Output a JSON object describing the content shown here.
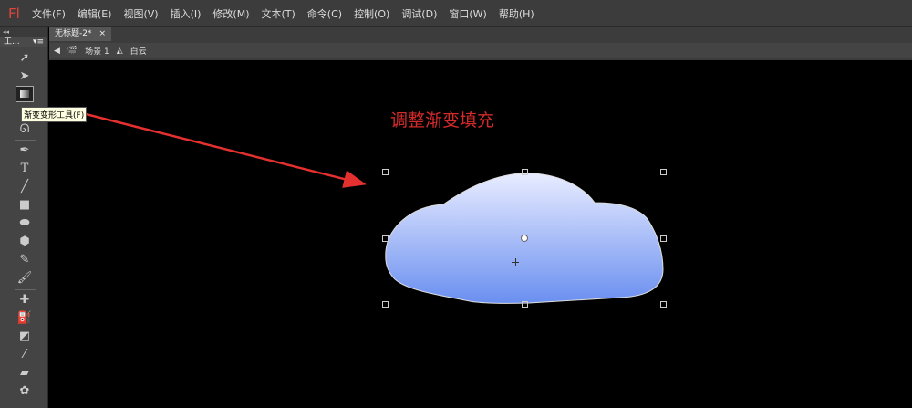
{
  "app": {
    "logo": "Fl"
  },
  "menu": [
    "文件(F)",
    "编辑(E)",
    "视图(V)",
    "插入(I)",
    "修改(M)",
    "文本(T)",
    "命令(C)",
    "控制(O)",
    "调试(D)",
    "窗口(W)",
    "帮助(H)"
  ],
  "tools_panel": {
    "collapse": "◂◂",
    "title": "工...",
    "menu": "▾≡"
  },
  "tooltip": "渐变变形工具(F)",
  "document": {
    "tab": "无标题-2*",
    "tab_close": "×",
    "scene": "场景 1",
    "symbol": "白云"
  },
  "stage": {
    "annotation": "调整渐变填充",
    "annotation_color": "#d42a2a",
    "gradient_top": "#e8ecff",
    "gradient_bottom": "#6a8ff0"
  }
}
